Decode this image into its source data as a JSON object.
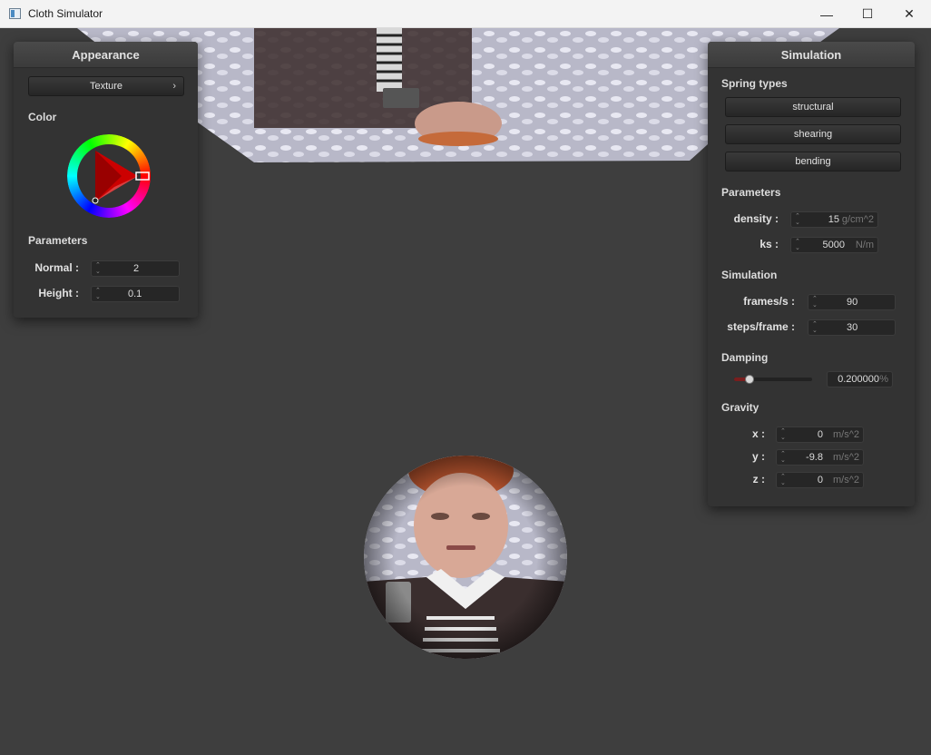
{
  "window": {
    "title": "Cloth Simulator",
    "controls": {
      "minimize": "—",
      "maximize": "☐",
      "close": "✕"
    }
  },
  "appearance": {
    "title": "Appearance",
    "shader_button": "Texture",
    "shader_chevron": "›",
    "color_section": "Color",
    "color_value": "#ff0000",
    "params_section": "Parameters",
    "normal_label": "Normal :",
    "normal_value": "2",
    "height_label": "Height :",
    "height_value": "0.1"
  },
  "simulation": {
    "title": "Simulation",
    "spring_section": "Spring types",
    "spring_buttons": [
      "structural",
      "shearing",
      "bending"
    ],
    "params_section": "Parameters",
    "density_label": "density :",
    "density_value": "15",
    "density_unit": "g/cm^2",
    "ks_label": "ks :",
    "ks_value": "5000",
    "ks_unit": "N/m",
    "sim_section": "Simulation",
    "fps_label": "frames/s :",
    "fps_value": "90",
    "steps_label": "steps/frame :",
    "steps_value": "30",
    "damping_section": "Damping",
    "damping_value": "0.200000",
    "damping_unit": "%",
    "damping_fraction": 0.2,
    "gravity_section": "Gravity",
    "gx_label": "x :",
    "gx_value": "0",
    "gy_label": "y :",
    "gy_value": "-9.8",
    "gz_label": "z :",
    "gz_value": "0",
    "gravity_unit": "m/s^2"
  }
}
